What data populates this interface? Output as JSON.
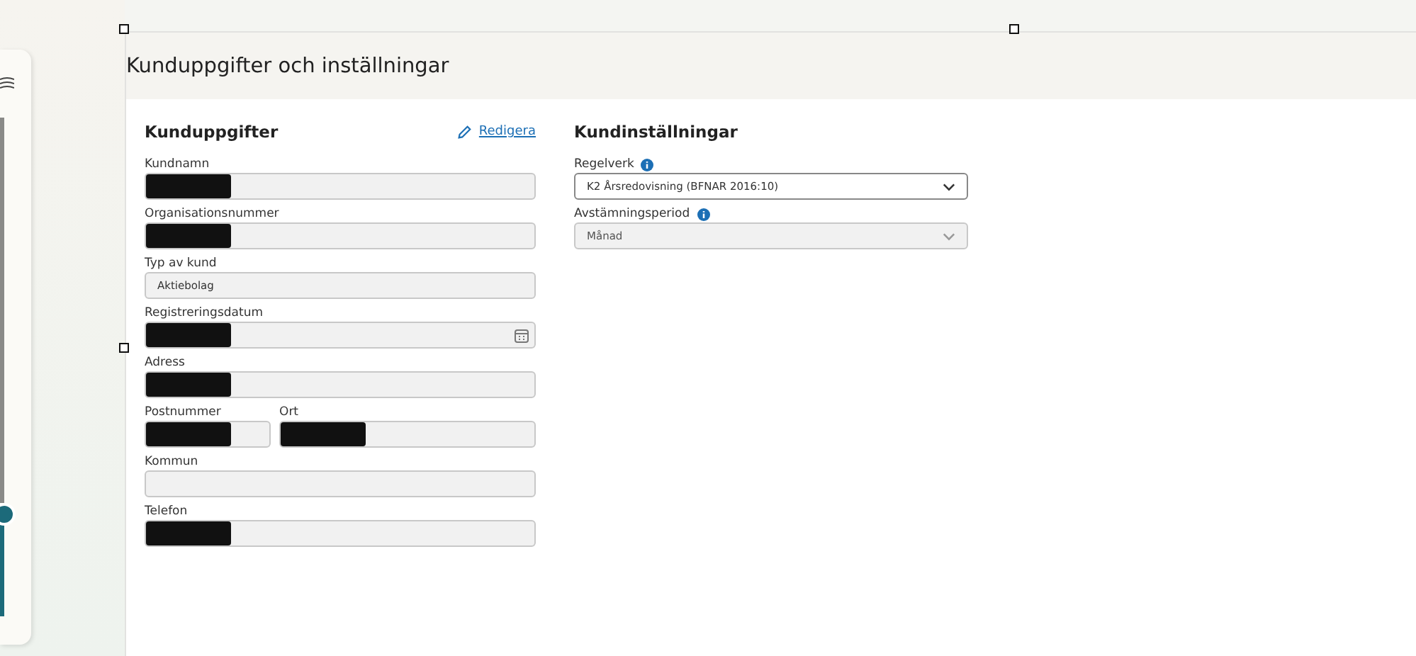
{
  "page_title": "Kunduppgifter och inställningar",
  "customer_details": {
    "title": "Kunduppgifter",
    "edit_link": "Redigera",
    "rows": [
      {
        "fields": [
          {
            "label": "Kundnamn",
            "kind": "text",
            "redacted": true
          }
        ]
      },
      {
        "fields": [
          {
            "label": "Organisationsnummer",
            "kind": "text",
            "redacted": true
          }
        ]
      },
      {
        "fields": [
          {
            "label": "Typ av kund",
            "kind": "text",
            "value": "Aktiebolag",
            "redacted": false
          }
        ]
      },
      {
        "fields": [
          {
            "label": "Registreringsdatum",
            "kind": "date",
            "redacted": true
          }
        ]
      },
      {
        "fields": [
          {
            "label": "Adress",
            "kind": "text",
            "redacted": true
          }
        ]
      },
      {
        "fields": [
          {
            "label": "Postnummer",
            "kind": "text",
            "redacted": true
          },
          {
            "label": "Ort",
            "kind": "text",
            "redacted": true
          }
        ]
      },
      {
        "fields": [
          {
            "label": "Kommun",
            "kind": "text",
            "redacted": false
          }
        ]
      },
      {
        "fields": [
          {
            "label": "Telefon",
            "kind": "text",
            "redacted": true
          }
        ]
      }
    ]
  },
  "customer_settings": {
    "title": "Kundinställningar",
    "fields": [
      {
        "label": "Regelverk",
        "value": "K2 Årsredovisning (BFNAR 2016:10)",
        "disabled": false
      },
      {
        "label": "Avstämningsperiod",
        "value": "Månad",
        "disabled": true
      }
    ]
  }
}
